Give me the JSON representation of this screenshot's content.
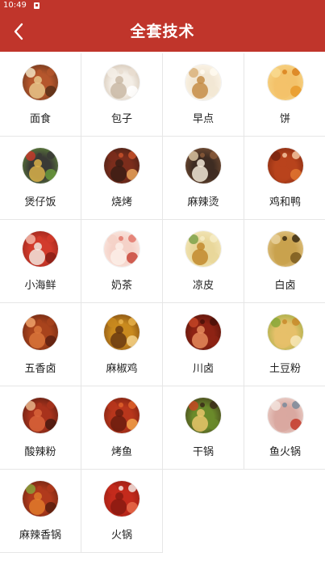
{
  "status_bar": {
    "time": "10:49"
  },
  "header": {
    "title": "全套技术"
  },
  "icons": {
    "back": "chevron-left-icon"
  },
  "colors": {
    "brand": "#c0352b"
  },
  "categories": [
    {
      "label": "面食",
      "icon": "noodles-dish-icon",
      "palette": [
        "#b5562c",
        "#e8c489",
        "#5a2f18",
        "#f3e3c2"
      ]
    },
    {
      "label": "包子",
      "icon": "steamed-buns-icon",
      "palette": [
        "#f4eee6",
        "#e9ddd0",
        "#c9b8a4",
        "#ffffff"
      ]
    },
    {
      "label": "早点",
      "icon": "breakfast-icon",
      "palette": [
        "#f2e7d4",
        "#d9b27a",
        "#fffaf0",
        "#c58c45"
      ]
    },
    {
      "label": "饼",
      "icon": "pancake-icon",
      "palette": [
        "#f3c26a",
        "#e79a2a",
        "#f8d98f",
        "#d9801c"
      ]
    },
    {
      "label": "煲仔饭",
      "icon": "claypot-rice-icon",
      "palette": [
        "#3a3a36",
        "#d9b14a",
        "#6a9a3c",
        "#c43a2a"
      ]
    },
    {
      "label": "烧烤",
      "icon": "barbecue-icon",
      "palette": [
        "#7b2d1c",
        "#c8512a",
        "#3b1d14",
        "#e7a35a"
      ]
    },
    {
      "label": "麻辣烫",
      "icon": "spicy-hotpot-soup-icon",
      "palette": [
        "#3e2c22",
        "#d7c2a0",
        "#8a5a3a",
        "#f1e7d6"
      ]
    },
    {
      "label": "鸡和鸭",
      "icon": "roast-poultry-icon",
      "palette": [
        "#b8431c",
        "#e0762f",
        "#7a2610",
        "#f4c6a0"
      ]
    },
    {
      "label": "小海鲜",
      "icon": "seafood-icon",
      "palette": [
        "#d23b2c",
        "#f2e6de",
        "#8a1f16",
        "#f5b7a8"
      ]
    },
    {
      "label": "奶茶",
      "icon": "milk-tea-icon",
      "palette": [
        "#f5d2c8",
        "#e2766a",
        "#fbeee8",
        "#c9463a"
      ]
    },
    {
      "label": "凉皮",
      "icon": "cold-noodles-icon",
      "palette": [
        "#e9d79a",
        "#7ea24a",
        "#f6ecc6",
        "#c28a2e"
      ]
    },
    {
      "label": "白卤",
      "icon": "braised-meat-icon",
      "palette": [
        "#c9a24e",
        "#7a5a1e",
        "#e8d09a",
        "#3a2a10"
      ]
    },
    {
      "label": "五香卤",
      "icon": "spiced-braise-icon",
      "palette": [
        "#a8431c",
        "#d9743a",
        "#5e2010",
        "#f0a26a"
      ]
    },
    {
      "label": "麻椒鸡",
      "icon": "pepper-chicken-icon",
      "palette": [
        "#c98a1e",
        "#e8b24a",
        "#6a3a10",
        "#f4d28a"
      ]
    },
    {
      "label": "川卤",
      "icon": "sichuan-braise-icon",
      "palette": [
        "#8e2314",
        "#c44426",
        "#4a1008",
        "#e58a5a"
      ]
    },
    {
      "label": "土豆粉",
      "icon": "potato-noodles-icon",
      "palette": [
        "#e6c06a",
        "#f7e8b8",
        "#8aa83a",
        "#c98a2a"
      ]
    },
    {
      "label": "酸辣粉",
      "icon": "hot-sour-noodles-icon",
      "palette": [
        "#a8321c",
        "#d9643a",
        "#4a1a10",
        "#e9b48a"
      ]
    },
    {
      "label": "烤鱼",
      "icon": "grilled-fish-icon",
      "palette": [
        "#b8361c",
        "#e0622a",
        "#6a1c0e",
        "#f2a24a"
      ]
    },
    {
      "label": "干锅",
      "icon": "dry-pot-icon",
      "palette": [
        "#6a8a2a",
        "#c44a22",
        "#3a2a18",
        "#e8c46a"
      ]
    },
    {
      "label": "鱼火锅",
      "icon": "fish-hotpot-icon",
      "palette": [
        "#d9a8a0",
        "#c43a2a",
        "#f2e2dc",
        "#7a8a9a"
      ]
    },
    {
      "label": "麻辣香锅",
      "icon": "spicy-pot-icon",
      "palette": [
        "#b03a1c",
        "#e07a2a",
        "#5a1e0e",
        "#8aa03a"
      ]
    },
    {
      "label": "火锅",
      "icon": "hotpot-icon",
      "palette": [
        "#c42a1c",
        "#f2e6e2",
        "#8a1a10",
        "#e86a4a"
      ]
    }
  ]
}
